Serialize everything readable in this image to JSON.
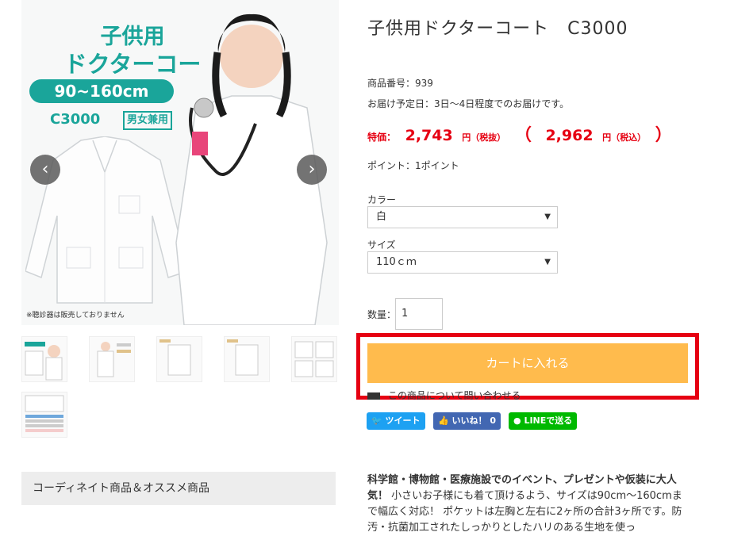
{
  "main_image": {
    "promo_line1": "子供用",
    "promo_line2": "ドクターコート",
    "size_range": "90~160cm",
    "model_code": "C3000",
    "unisex_label": "男女兼用",
    "note": "※聴診器は販売しておりません",
    "prev_arrow": "‹",
    "next_arrow": "›"
  },
  "coordinate_header": "コーディネイト商品＆オススメ商品",
  "product": {
    "title": "子供用ドクターコート　C3000",
    "number_line": "商品番号：939",
    "delivery_line": "お届け予定日：3日～4日程度でのお届けです。",
    "price_label": "特価：",
    "price_ex": "2,743",
    "price_ex_unit": "円（税抜）",
    "paren_open": "（",
    "price_in": "2,962",
    "price_in_unit": "円（税込）",
    "paren_close": "）",
    "points": "ポイント：1ポイント"
  },
  "options": {
    "color_label": "カラー",
    "color_value": "白",
    "size_label": "サイズ",
    "size_value": "110ｃｍ",
    "select_arrow": "▼"
  },
  "quantity": {
    "label": "数量：",
    "value": "1"
  },
  "cart_button": "カートに入れる",
  "inquiry": "この商品について問い合わせる",
  "social": {
    "tweet": "ツイート",
    "like": "いいね！ 0",
    "line": "LINEで送る"
  },
  "description": {
    "bold": "科学館・博物館・医療施設でのイベント、プレゼントや仮装に大人気！",
    "text": " 小さいお子様にも着て頂けるよう、サイズは90cm～160cmまで幅広く対応！ ポケットは左胸と左右に2ヶ所の合計3ヶ所です。防汚・抗菌加工されたしっかりとしたハリのある生地を使っ"
  },
  "colors": {
    "teal": "#1aa59a",
    "price_red": "#e60012",
    "cart_orange": "#ffbb4d",
    "twitter": "#1da1f2",
    "facebook": "#4267b2",
    "line": "#00b900"
  }
}
